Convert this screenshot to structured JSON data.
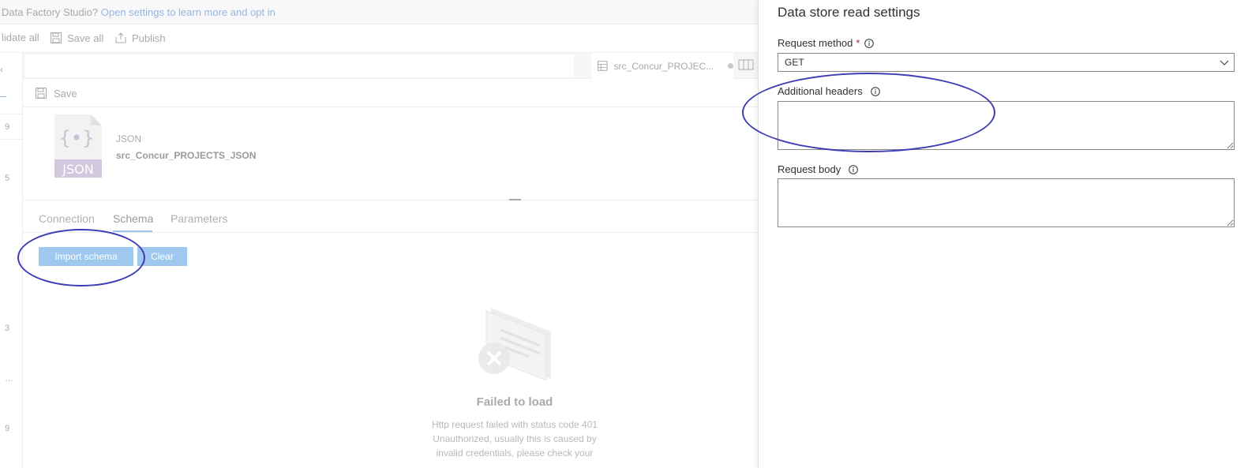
{
  "banner": {
    "prefix": "Data Factory Studio?",
    "link": "Open settings to learn more and opt in"
  },
  "toolbar": {
    "validate_label": "lidate all",
    "save_all_label": "Save all",
    "publish_label": "Publish"
  },
  "left_rail": {
    "numbers": [
      "9",
      "5",
      "3",
      "…",
      "9"
    ]
  },
  "document_tab": {
    "label": "src_Concur_PROJEC..."
  },
  "savebar": {
    "save_label": "Save"
  },
  "dataset": {
    "icon_label": "JSON",
    "type": "JSON",
    "name": "src_Concur_PROJECTS_JSON"
  },
  "tabs": [
    {
      "label": "Connection"
    },
    {
      "label": "Schema"
    },
    {
      "label": "Parameters"
    }
  ],
  "actions": {
    "import_schema": "Import schema",
    "clear": "Clear"
  },
  "error": {
    "title": "Failed to load",
    "message": "Http request failed with status code 401 Unauthorized, usually this is caused by invalid credentials, please check your"
  },
  "panel": {
    "title": "Data store read settings",
    "request_method_label": "Request method",
    "request_method_required": "*",
    "request_method_value": "GET",
    "additional_headers_label": "Additional headers",
    "additional_headers_value": "",
    "request_body_label": "Request body",
    "request_body_value": ""
  },
  "colors": {
    "accent": "#0078d4",
    "annotation": "#3c3cb4",
    "required": "#a4262c"
  }
}
